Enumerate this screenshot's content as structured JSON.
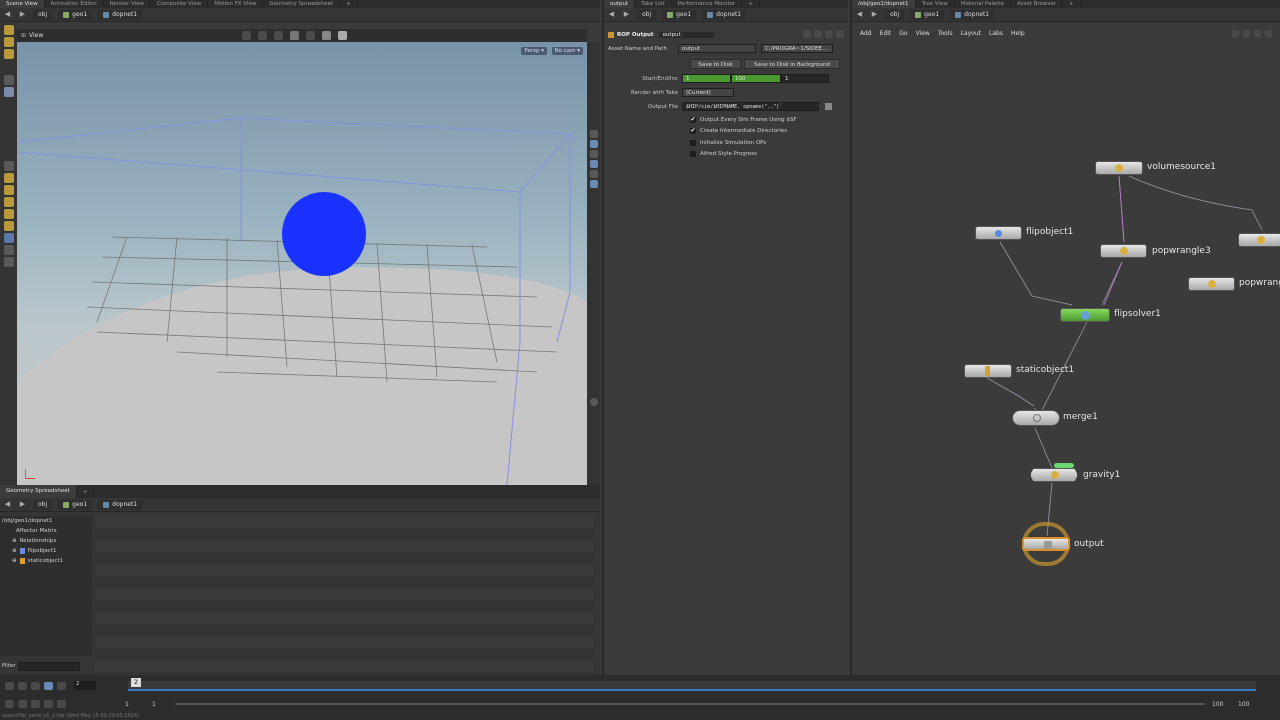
{
  "left_tabs": [
    "Scene View",
    "Animation Editor",
    "Render View",
    "Composite View",
    "Motion FX View",
    "Geometry Spreadsheet"
  ],
  "left_path": {
    "obj": "obj",
    "geo": "geo1",
    "dop": "dopnet1"
  },
  "viewport": {
    "label": "View",
    "persp": "Persp",
    "cam": "No cam"
  },
  "mid_tabs": [
    "output",
    "Take List",
    "Performance Monitor"
  ],
  "mid_path": {
    "obj": "obj",
    "geo": "geo1",
    "dop": "dopnet1"
  },
  "rop": {
    "type_label": "ROP Output",
    "name": "output",
    "asset_label": "Asset Name and Path",
    "asset_value": "output",
    "asset_path": "C:/PROGRA~1/SIDEE...",
    "save_disk": "Save to Disk",
    "save_bg": "Save to Disk in Background",
    "start_label": "Start/End/Inc",
    "start": "1",
    "end": "100",
    "inc": "1",
    "take_label": "Render with Take",
    "take_value": "(Current)",
    "file_label": "Output File",
    "file_value": "$HIP/sim/$HIPNAME.`opname(\"..\")`",
    "checks": [
      {
        "label": "Output Every Sim Frame Using $SF",
        "checked": true
      },
      {
        "label": "Create Intermediate Directories",
        "checked": true
      },
      {
        "label": "Initialize Simulation OPs",
        "checked": false
      },
      {
        "label": "Alfred Style Progress",
        "checked": false
      }
    ]
  },
  "right_tabs": [
    "/obj/geo2/dopnet1",
    "Tree View",
    "Material Palette",
    "Asset Browser"
  ],
  "right_path": {
    "obj": "obj",
    "geo": "geo1",
    "dop": "dopnet1"
  },
  "network_menu": [
    "Add",
    "Edit",
    "Go",
    "View",
    "Tools",
    "Layout",
    "Labs",
    "Help"
  ],
  "nodes": {
    "volumesource": "volumesource1",
    "flipobject": "flipobject1",
    "popwrangle3": "popwrangle3",
    "popwrangle_partial": "popwrang",
    "flipsolver": "flipsolver1",
    "staticobject": "staticobject1",
    "merge": "merge1",
    "gravity": "gravity1",
    "output": "output"
  },
  "spreadsheet": {
    "tab": "Geometry Spreadsheet",
    "path": {
      "obj": "obj",
      "geo": "geo1",
      "dop": "dopnet1"
    },
    "tree": [
      "/obj/geo1/dopnet1",
      "Affector Matrix",
      "Relationships",
      "flipobject1",
      "staticobject1"
    ],
    "filter_label": "Filter"
  },
  "timeline": {
    "frame": "2",
    "current": "2",
    "start_a": "1",
    "start_b": "1",
    "end_a": "100",
    "end_b": "100",
    "status": "saved/flip_sand_v5_2.hip (Wed May 15 00:20:05 2024)"
  },
  "colors": {
    "sphere": "#1a32ff",
    "flip": "#5aa632",
    "output_ring": "#c89632"
  }
}
